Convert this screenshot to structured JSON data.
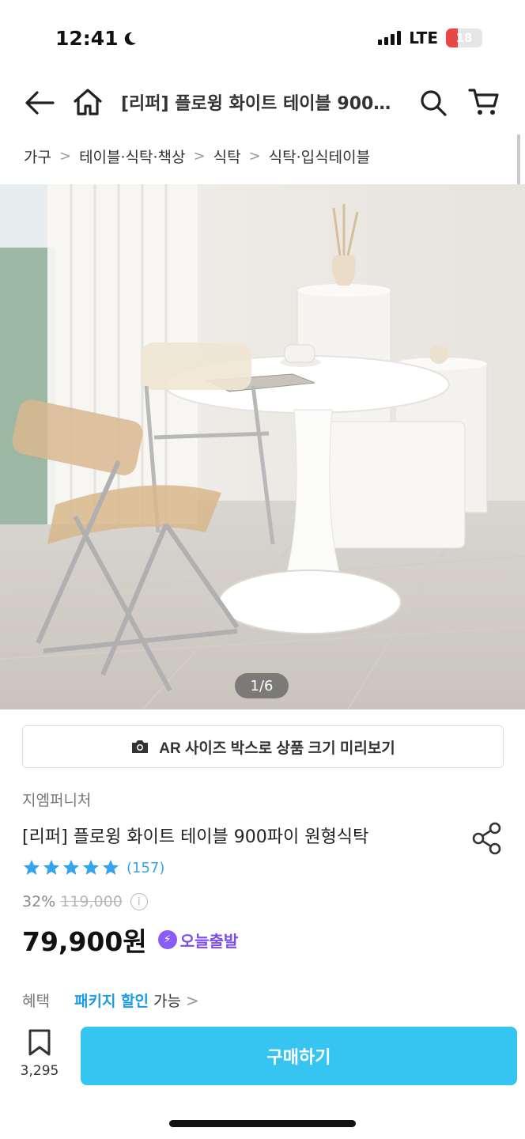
{
  "status_bar": {
    "time": "12:41",
    "network": "LTE",
    "battery": "18",
    "battery_level": 0.18
  },
  "header": {
    "title": "[리퍼] 플로윙 화이트 테이블 900…",
    "back_icon": "arrow-left-icon",
    "home_icon": "home-icon",
    "search_icon": "search-icon",
    "cart_icon": "cart-icon"
  },
  "breadcrumb": [
    "가구",
    "테이블·식탁·책상",
    "식탁",
    "식탁·입식테이블"
  ],
  "gallery": {
    "indicator": "1/6"
  },
  "ar_button": {
    "label": "AR 사이즈 박스로 상품 크기 미리보기",
    "icon": "camera-icon"
  },
  "product": {
    "brand": "지엠퍼니처",
    "name": "[리퍼] 플로윙 화이트 테이블 900파이 원형식탁",
    "rating_stars": 5,
    "review_count": "(157)",
    "discount_rate": "32%",
    "original_price": "119,000",
    "price": "79,900원",
    "delivery_badge": "오늘출발"
  },
  "benefit": {
    "label": "혜택",
    "link": "패키지 할인",
    "suffix": "가능"
  },
  "bottom_bar": {
    "bookmark_count": "3,295",
    "buy_label": "구매하기"
  },
  "colors": {
    "accent": "#35c5f0",
    "link": "#1c9be4",
    "badge": "#7c4dea",
    "star": "#35a4ec"
  }
}
